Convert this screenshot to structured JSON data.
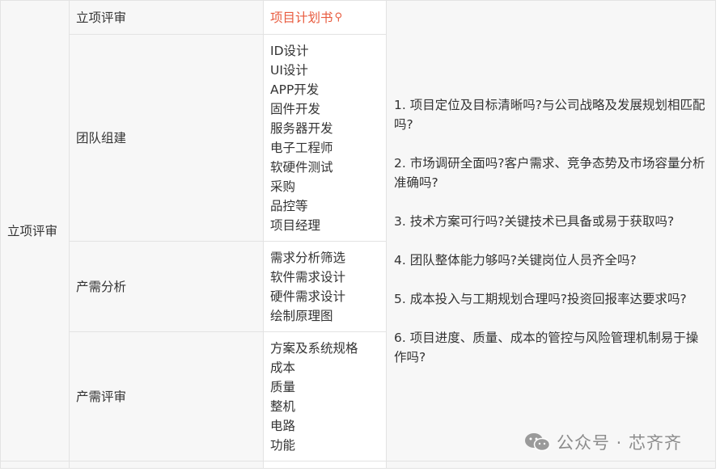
{
  "table": {
    "stage": "立项评审",
    "row1": {
      "label": "立项评审",
      "link": "项目计划书"
    },
    "row2": {
      "label": "团队组建",
      "items": [
        "ID设计",
        "UI设计",
        "APP开发",
        "固件开发",
        "服务器开发",
        "电子工程师",
        "软硬件测试",
        "采购",
        "品控等",
        "项目经理"
      ]
    },
    "row3": {
      "label": "产需分析",
      "items": [
        "需求分析筛选",
        "软件需求设计",
        "硬件需求设计",
        "绘制原理图"
      ]
    },
    "row4": {
      "label": "产需评审",
      "items": [
        "方案及系统规格",
        "成本",
        "质量",
        "整机",
        "电路",
        "功能"
      ]
    },
    "questions": [
      "1. 项目定位及目标清晰吗?与公司战略及发展规划相匹配吗?",
      "2. 市场调研全面吗?客户需求、竞争态势及市场容量分析准确吗?",
      "3. 技术方案可行吗?关键技术已具备或易于获取吗?",
      "4. 团队整体能力够吗?关键岗位人员齐全吗?",
      "5. 成本投入与工期规划合理吗?投资回报率达要求吗?",
      "6. 项目进度、质量、成本的管控与风险管理机制易于操作吗?"
    ]
  },
  "watermark": {
    "text": "公众号 · 芯齐齐",
    "icon": "wechat-icon"
  }
}
